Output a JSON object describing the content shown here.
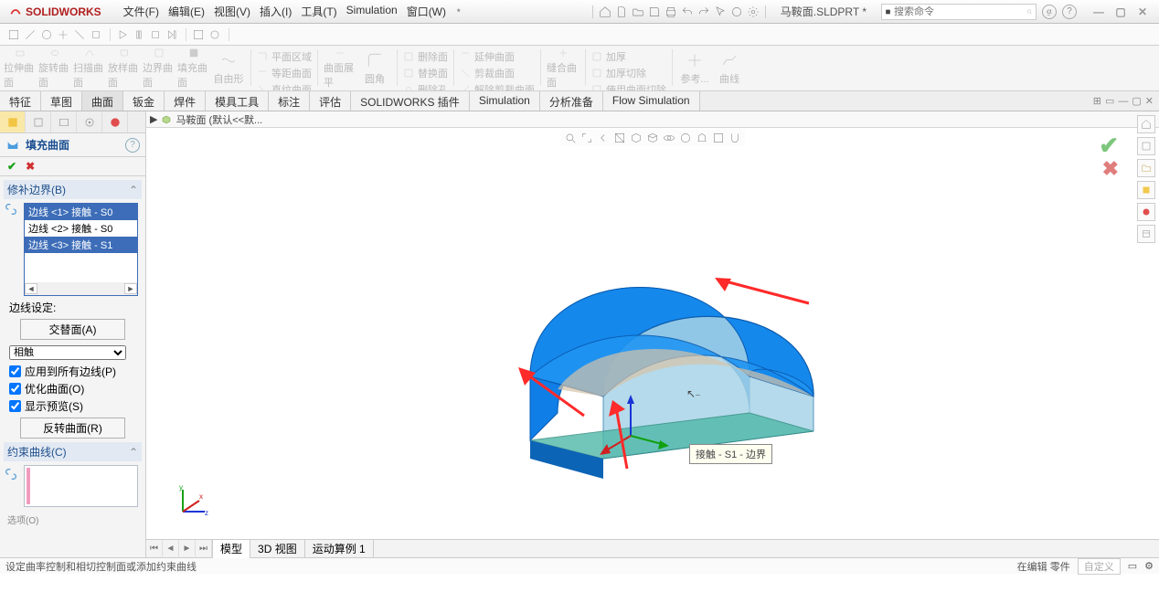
{
  "app": {
    "brand": "SOLIDWORKS"
  },
  "menu": {
    "file": "文件(F)",
    "edit": "编辑(E)",
    "view": "视图(V)",
    "insert": "插入(I)",
    "tools": "工具(T)",
    "simulation": "Simulation",
    "window": "窗口(W)"
  },
  "document": {
    "name": "马鞍面.SLDPRT *"
  },
  "search": {
    "placeholder": "搜索命令"
  },
  "ribbon_btns": {
    "b1": "拉伸曲面",
    "b2": "旋转曲面",
    "b3": "扫描曲面",
    "b4": "放样曲面",
    "b5": "边界曲面",
    "b6": "填充曲面",
    "b7": "自由形",
    "c1": "平面区域",
    "c2": "等距曲面",
    "c3": "直纹曲面",
    "d1": "曲面展平",
    "d2": "圆角",
    "e1": "删除面",
    "e2": "替换面",
    "e3": "删除孔",
    "f1": "延伸曲面",
    "f2": "剪裁曲面",
    "f3": "解除剪裁曲面",
    "g1": "缝合曲面",
    "h1": "加厚",
    "h2": "加厚切除",
    "h3": "使用曲面切除",
    "i1": "参考...",
    "i2": "曲线"
  },
  "tabs": {
    "t1": "特征",
    "t2": "草图",
    "t3": "曲面",
    "t4": "钣金",
    "t5": "焊件",
    "t6": "模具工具",
    "t7": "标注",
    "t8": "评估",
    "t9": "SOLIDWORKS 插件",
    "t10": "Simulation",
    "t11": "分析准备",
    "t12": "Flow Simulation"
  },
  "pm": {
    "title": "填充曲面",
    "section_patch": "修补边界(B)",
    "rows": {
      "r1": "边线 <1> 接触 - S0",
      "r2": "边线 <2> 接触 - S0",
      "r3": "边线 <3> 接触 - S1"
    },
    "edge_setting": "边线设定:",
    "btn_alt": "交替面(A)",
    "sel_contact": "相触",
    "chk_apply": "应用到所有边线(P)",
    "chk_opt": "优化曲面(O)",
    "chk_preview": "显示预览(S)",
    "btn_reverse": "反转曲面(R)",
    "section_constraint": "约束曲线(C)",
    "options": "选项(O)"
  },
  "breadcrumb": {
    "part": "马鞍面  (默认<<默..."
  },
  "tooltip": {
    "txt": "接触 - S1 - 边界"
  },
  "bottom": {
    "model": "模型",
    "view3d": "3D 视图",
    "motion": "运动算例 1"
  },
  "status": {
    "left": "设定曲率控制和相切控制面或添加约束曲线",
    "mode": "在编辑 零件",
    "custom": "自定义"
  }
}
